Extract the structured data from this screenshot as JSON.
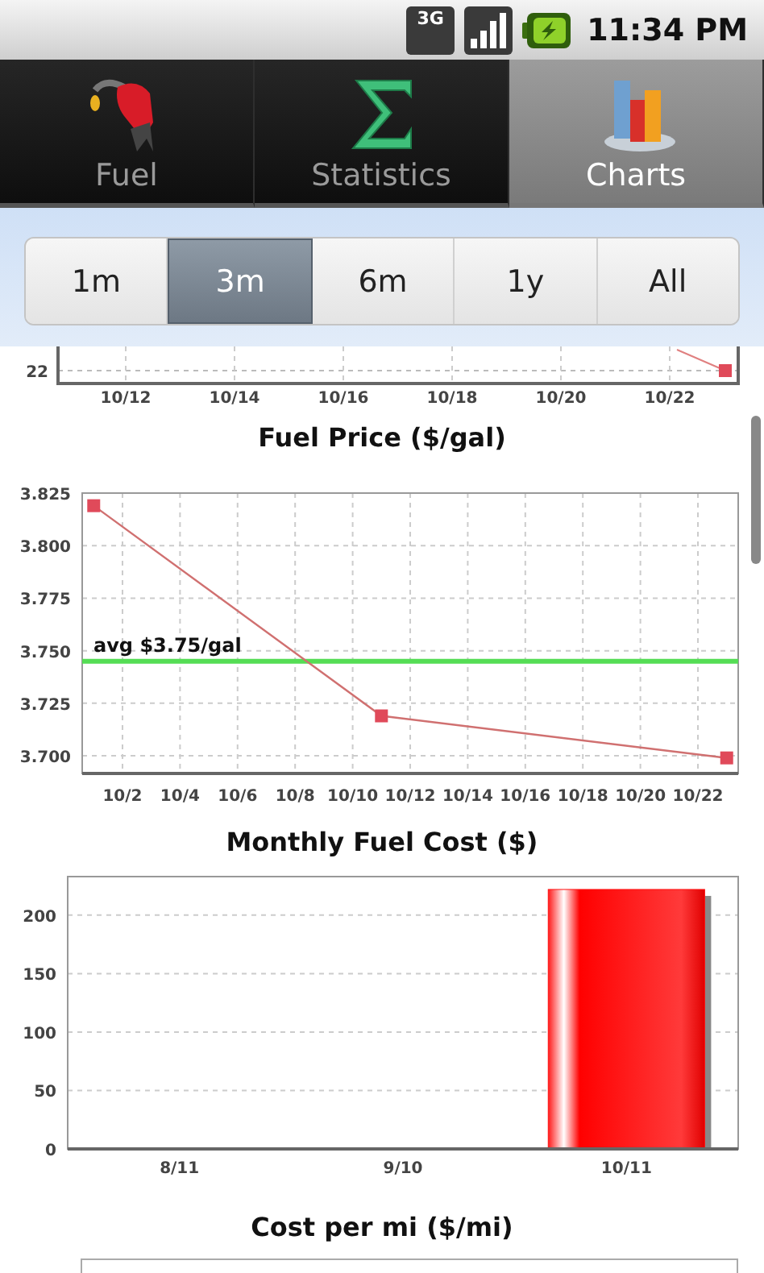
{
  "status_bar": {
    "network": "3G",
    "time": "11:34 PM"
  },
  "tabs": [
    {
      "label": "Fuel",
      "kind": "fuel",
      "selected": false
    },
    {
      "label": "Statistics",
      "kind": "sigma",
      "selected": false
    },
    {
      "label": "Charts",
      "kind": "chart",
      "selected": true
    }
  ],
  "periods": [
    {
      "label": "1m",
      "selected": false
    },
    {
      "label": "3m",
      "selected": true
    },
    {
      "label": "6m",
      "selected": false
    },
    {
      "label": "1y",
      "selected": false
    },
    {
      "label": "All",
      "selected": false
    }
  ],
  "top_chart": {
    "yticks": [
      "22"
    ],
    "xticks": [
      "10/12",
      "10/14",
      "10/16",
      "10/18",
      "10/20",
      "10/22"
    ]
  },
  "fuel_price": {
    "chart_data": {
      "type": "line",
      "title": "Fuel Price ($/gal)",
      "categories": [
        null,
        "10/2",
        null,
        "10/4",
        null,
        "10/6",
        null,
        "10/8",
        null,
        "10/10",
        null,
        "10/12",
        null,
        "10/14",
        null,
        "10/16",
        null,
        "10/18",
        null,
        "10/20",
        null,
        "10/22",
        null
      ],
      "series": [
        {
          "color": "#e04a5a",
          "marker": "square",
          "values": [
            3.819,
            null,
            null,
            null,
            null,
            null,
            null,
            null,
            null,
            null,
            3.719,
            null,
            null,
            null,
            null,
            null,
            null,
            null,
            null,
            null,
            null,
            null,
            3.699
          ]
        }
      ],
      "ylim": [
        3.6916,
        3.825
      ],
      "grid": true,
      "yticks": [
        {
          "value": 3.7,
          "label": "3.700"
        },
        {
          "value": 3.725,
          "label": "3.725"
        },
        {
          "value": 3.75,
          "label": "3.750"
        },
        {
          "value": 3.775,
          "label": "3.775"
        },
        {
          "value": 3.8,
          "label": "3.800"
        },
        {
          "value": 3.825,
          "label": "3.825"
        }
      ],
      "ref_lines": [
        {
          "axis": "y",
          "value": 3.745,
          "label": "avg $3.75/gal",
          "color": "#55dd55"
        }
      ]
    }
  },
  "monthly_cost": {
    "chart_data": {
      "type": "bar",
      "title": "Monthly Fuel Cost ($)",
      "categories": [
        "8/11",
        "9/10",
        "10/11"
      ],
      "series": [
        {
          "color": "#ff1010",
          "values": [
            null,
            null,
            222
          ]
        }
      ],
      "ylim": [
        0,
        233
      ],
      "yticks": [
        0,
        50,
        100,
        150,
        200
      ],
      "grid": true
    }
  },
  "cost_per_mi": {
    "title": "Cost per mi ($/mi)"
  }
}
